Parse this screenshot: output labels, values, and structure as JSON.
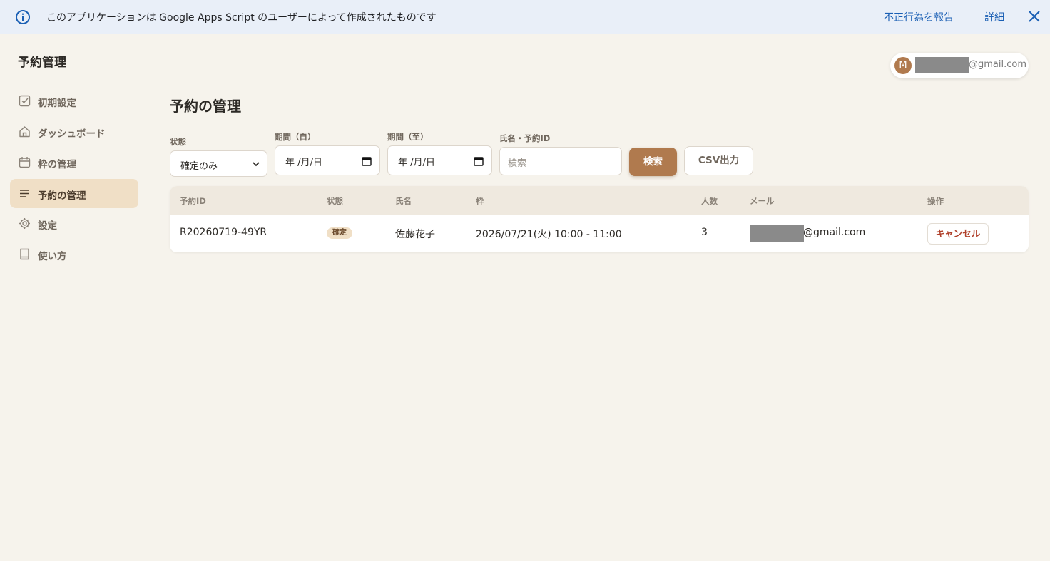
{
  "banner": {
    "message": "このアプリケーションは Google Apps Script のユーザーによって作成されたものです",
    "report_link": "不正行為を報告",
    "details_link": "詳細"
  },
  "sidebar": {
    "app_title": "予約管理",
    "items": [
      {
        "label": "初期設定",
        "icon": "checkbox-icon"
      },
      {
        "label": "ダッシュボード",
        "icon": "home-icon"
      },
      {
        "label": "枠の管理",
        "icon": "calendar-icon"
      },
      {
        "label": "予約の管理",
        "icon": "list-icon",
        "active": true
      },
      {
        "label": "設定",
        "icon": "gear-icon"
      },
      {
        "label": "使い方",
        "icon": "book-icon"
      }
    ]
  },
  "account": {
    "avatar_initial": "M",
    "email_suffix": "@gmail.com"
  },
  "main": {
    "title": "予約の管理",
    "filters": {
      "status_label": "状態",
      "status_value": "確定のみ",
      "from_label": "期間（自）",
      "from_value": "年 /月/日",
      "to_label": "期間（至）",
      "to_value": "年 /月/日",
      "query_label": "氏名・予約ID",
      "query_placeholder": "検索"
    },
    "search_button": "検索",
    "csv_button": "CSV出力"
  },
  "table": {
    "columns": [
      "予約ID",
      "状態",
      "氏名",
      "枠",
      "人数",
      "メール",
      "操作"
    ],
    "rows": [
      {
        "id": "R20260719-49YR",
        "status": "確定",
        "name": "佐藤花子",
        "slot": "2026/07/21(火) 10:00 - 11:00",
        "people": "3",
        "email_suffix": "@gmail.com",
        "action": "キャンセル"
      }
    ]
  },
  "colors": {
    "accent": "#b07a4e",
    "active_nav": "#f0dfc6",
    "background": "#f6f3ec",
    "banner": "#e9eff8",
    "link": "#1a5fb4",
    "cancel": "#b0402a"
  }
}
